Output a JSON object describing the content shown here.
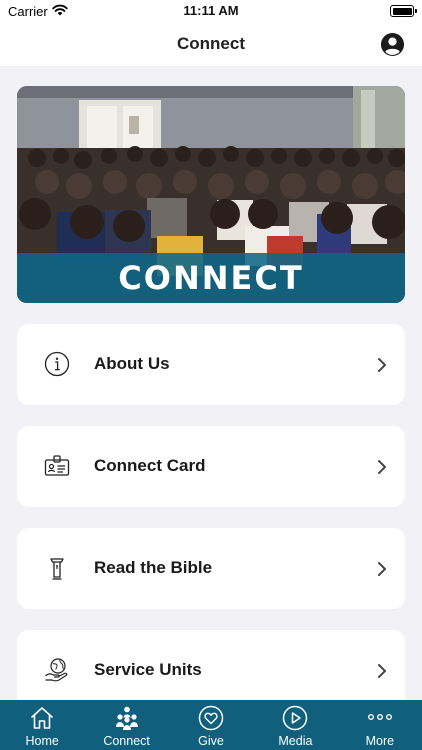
{
  "status_bar": {
    "carrier": "Carrier",
    "time": "11:11 AM"
  },
  "nav": {
    "title": "Connect",
    "profile_icon": "person-circle-icon"
  },
  "hero": {
    "banner_text": "CONNECT"
  },
  "menu": {
    "items": [
      {
        "label": "About Us",
        "icon": "info-circle-icon"
      },
      {
        "label": "Connect Card",
        "icon": "id-card-icon"
      },
      {
        "label": "Read the Bible",
        "icon": "pulpit-icon"
      },
      {
        "label": "Service Units",
        "icon": "globe-in-hand-icon"
      }
    ]
  },
  "tab_bar": {
    "background": "#0f5f7d",
    "tabs": [
      {
        "label": "Home",
        "icon": "home-icon"
      },
      {
        "label": "Connect",
        "icon": "people-icon"
      },
      {
        "label": "Give",
        "icon": "heart-circle-icon"
      },
      {
        "label": "Media",
        "icon": "play-circle-icon"
      },
      {
        "label": "More",
        "icon": "more-dots-icon"
      }
    ]
  }
}
